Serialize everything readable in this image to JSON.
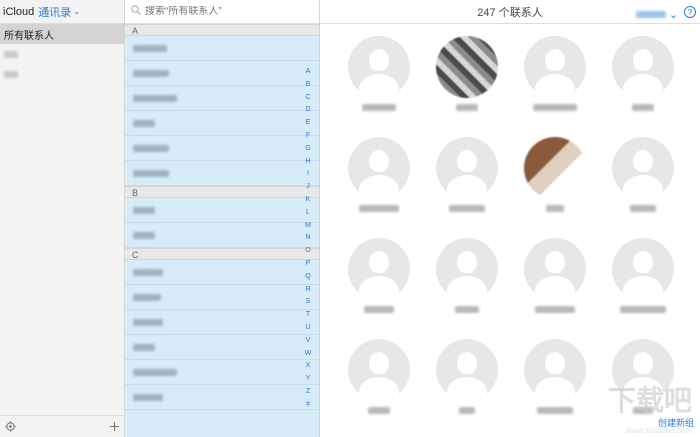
{
  "sidebar": {
    "brand": "iCloud",
    "book": "通讯录",
    "groups": [
      {
        "label": "所有联系人",
        "selected": true
      },
      {
        "label": "",
        "selected": false
      },
      {
        "label": "",
        "selected": false
      }
    ],
    "settings_icon": "gear-icon",
    "add_icon": "plus-icon"
  },
  "search": {
    "placeholder": "搜索“所有联系人”"
  },
  "list": {
    "sections": [
      {
        "letter": "A",
        "rows": 6
      },
      {
        "letter": "B",
        "rows": 2
      },
      {
        "letter": "C",
        "rows": 6
      }
    ],
    "index": [
      "A",
      "B",
      "C",
      "D",
      "E",
      "F",
      "G",
      "H",
      "I",
      "J",
      "K",
      "L",
      "M",
      "N",
      "O",
      "P",
      "Q",
      "R",
      "S",
      "T",
      "U",
      "V",
      "W",
      "X",
      "Y",
      "Z",
      "#"
    ]
  },
  "main": {
    "title": "247 个联系人",
    "help": "?",
    "footer_link": "创建新组",
    "watermark": "下载吧",
    "watermark_url": "www.xiazaiba.com"
  },
  "colors": {
    "accent": "#2b7bd6",
    "list_bg": "#d8ebf8"
  }
}
